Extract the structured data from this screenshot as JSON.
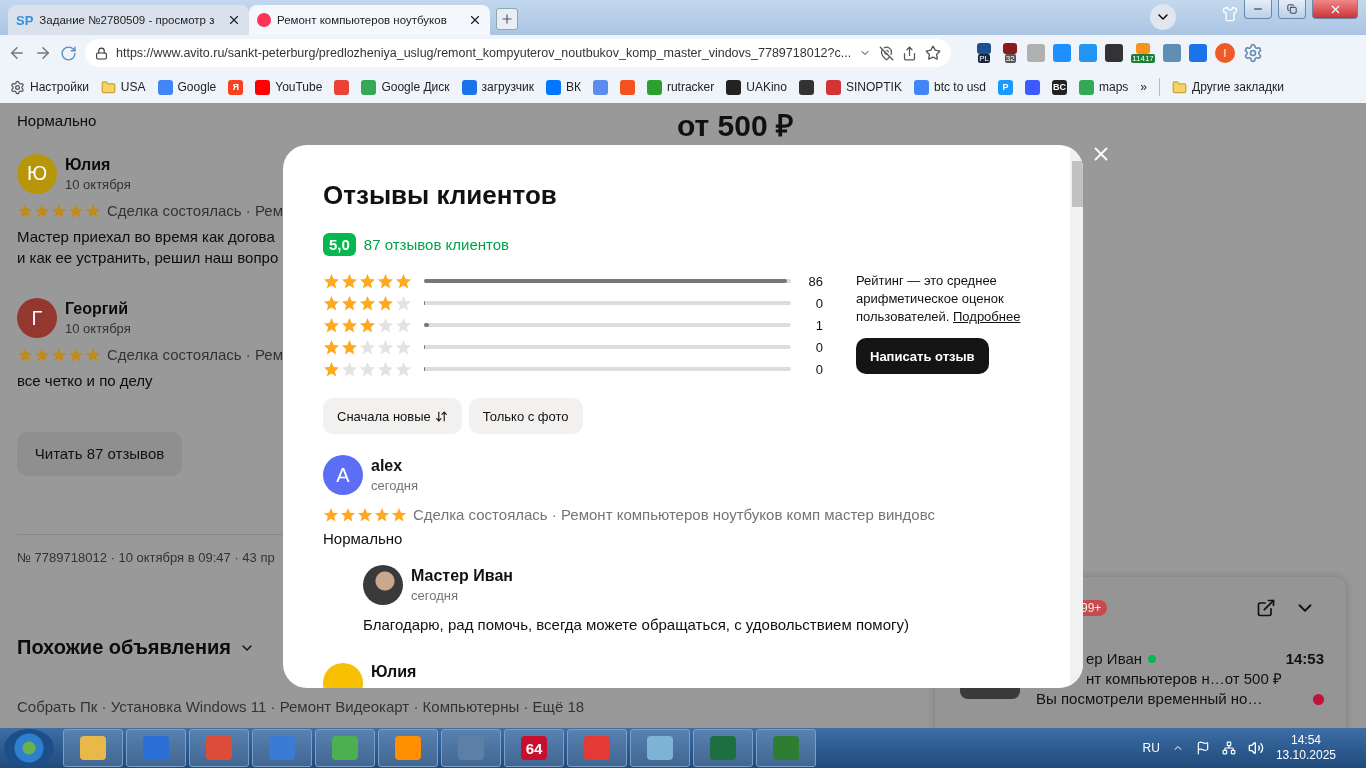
{
  "browser": {
    "tabs": [
      {
        "favicon": "SP",
        "title": "Задание №2780509 - просмотр з",
        "selected": false
      },
      {
        "title": "Ремонт компьютеров ноутбуков",
        "selected": true
      }
    ],
    "address": "https://www.avito.ru/sankt-peterburg/predlozheniya_uslug/remont_kompyuterov_noutbukov_komp_master_vindovs_7789718012?c...",
    "extensions": [
      {
        "kind": "badged",
        "badge": "PL"
      },
      {
        "kind": "badged",
        "badge": "32"
      },
      {
        "kind": "plain"
      },
      {
        "kind": "plain"
      },
      {
        "kind": "plain"
      },
      {
        "kind": "plain"
      },
      {
        "kind": "badged",
        "badge": "11417"
      },
      {
        "kind": "plain"
      },
      {
        "kind": "plain"
      }
    ],
    "profile": "I",
    "bookmarks": [
      {
        "kind": "settings",
        "label": "Настройки"
      },
      {
        "kind": "folder",
        "label": "USA"
      },
      {
        "kind": "site",
        "label": "Google"
      },
      {
        "kind": "site",
        "icon_text": "Я"
      },
      {
        "kind": "site",
        "label": "YouTube"
      },
      {
        "kind": "site"
      },
      {
        "kind": "site",
        "label": "Google Диск"
      },
      {
        "kind": "site",
        "label": "загрузчик"
      },
      {
        "kind": "site",
        "label": "ВК"
      },
      {
        "kind": "site"
      },
      {
        "kind": "site"
      },
      {
        "kind": "site",
        "label": "rutracker"
      },
      {
        "kind": "site",
        "label": "UAKino"
      },
      {
        "kind": "site"
      },
      {
        "kind": "site",
        "label": "SINOPTIK"
      },
      {
        "kind": "site",
        "label": "btc to usd"
      },
      {
        "kind": "site",
        "icon_text": "P"
      },
      {
        "kind": "site"
      },
      {
        "kind": "site",
        "icon_text": "BC"
      },
      {
        "kind": "site",
        "label": "maps"
      }
    ],
    "more": "»",
    "other_bookmarks": "Другие закладки"
  },
  "page": {
    "top_text": "Нормально",
    "reviews": [
      {
        "initial": "Ю",
        "color": "#b8960b",
        "name": "Юлия",
        "date": "10 октября",
        "stars": 5,
        "meta": "Сделка состоялась · Рем",
        "lines": [
          "Мастер приехал во время как догова",
          "и как ее устранить, решил наш вопро"
        ]
      },
      {
        "initial": "Г",
        "color": "#93372f",
        "name": "Георгий",
        "date": "10 октября",
        "stars": 5,
        "meta": "Сделка состоялась · Рем",
        "lines": [
          "все четко и по делу"
        ]
      }
    ],
    "read_button": "Читать 87 отзывов",
    "listing_info": "№ 7789718012 · 10 октября в 09:47 · 43 пр",
    "similar_heading": "Похожие объявления",
    "similar_links": "Собрать Пк · Установка Windows 11 · Ремонт Видеокарт · Компьютерны · Ещё 18",
    "price": "от 500 ₽"
  },
  "chat": {
    "badge": "99+",
    "name": "ер Иван",
    "online": true,
    "time": "14:53",
    "subject": "нт компьютеров н…от 500 ₽",
    "message": "Вы посмотрели временный но…",
    "unread": true
  },
  "modal": {
    "title": "Отзывы клиентов",
    "score": "5,0",
    "count_link": "87 отзывов клиентов",
    "distribution": [
      {
        "stars": 5,
        "level": 0.99,
        "count": "86"
      },
      {
        "stars": 4,
        "level": 0,
        "count": "0"
      },
      {
        "stars": 3,
        "level": 0.013,
        "count": "1"
      },
      {
        "stars": 2,
        "level": 0,
        "count": "0"
      },
      {
        "stars": 1,
        "level": 0,
        "count": "0"
      }
    ],
    "note": "Рейтинг — это среднее арифметическое оценок пользователей.",
    "note_link": "Подробнее",
    "write_button": "Написать отзыв",
    "filters": [
      {
        "kind": "sort",
        "label": "Сначала новые"
      },
      {
        "kind": "plain",
        "label": "Только с фото"
      }
    ],
    "reviews": [
      {
        "initial": "A",
        "color": "#5b6ef5",
        "name": "alex",
        "date": "сегодня",
        "stars": 5,
        "meta": "Сделка состоялась · Ремонт компьютеров ноутбуков комп мастер виндовс",
        "text": "Нормально",
        "reply": {
          "name": "Мастер Иван",
          "date": "сегодня",
          "text": "Благодарю, рад помочь, всегда можете обращаться, с удовольствием помогу)"
        }
      },
      {
        "color": "#f6c000",
        "name": "Юлия"
      }
    ]
  },
  "taskbar": {
    "apps": [
      {
        "kind": "icon"
      },
      {
        "kind": "icon"
      },
      {
        "kind": "icon"
      },
      {
        "kind": "icon"
      },
      {
        "kind": "icon"
      },
      {
        "kind": "icon"
      },
      {
        "kind": "icon"
      },
      {
        "kind": "text",
        "text": "64"
      },
      {
        "kind": "icon"
      },
      {
        "kind": "icon"
      },
      {
        "kind": "icon"
      },
      {
        "kind": "icon"
      }
    ],
    "language": "RU",
    "time": "14:54",
    "date": "13.10.2025"
  }
}
